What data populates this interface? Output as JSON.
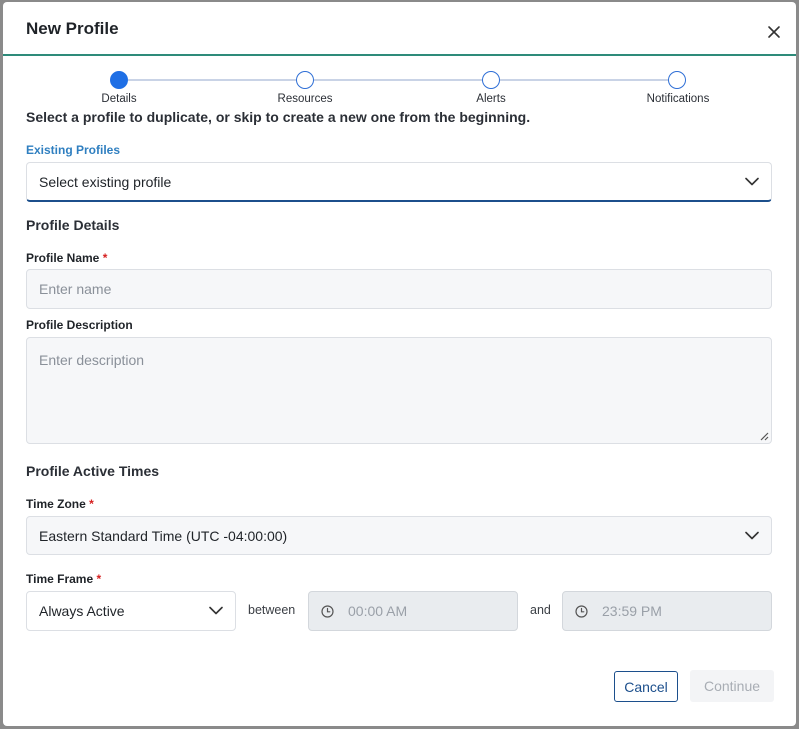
{
  "modal": {
    "title": "New Profile"
  },
  "stepper": {
    "steps": [
      {
        "label": "Details",
        "state": "active"
      },
      {
        "label": "Resources",
        "state": "pending"
      },
      {
        "label": "Alerts",
        "state": "pending"
      },
      {
        "label": "Notifications",
        "state": "pending"
      }
    ]
  },
  "instruction": "Select a profile to duplicate, or skip to create a new one from the beginning.",
  "existing_profiles": {
    "label": "Existing Profiles",
    "value": "Select existing profile"
  },
  "profile_details": {
    "section_title": "Profile Details",
    "name_label": "Profile Name",
    "name_placeholder": "Enter name",
    "name_value": "",
    "description_label": "Profile Description",
    "description_placeholder": "Enter description",
    "description_value": ""
  },
  "active_times": {
    "section_title": "Profile Active Times",
    "timezone_label": "Time Zone",
    "timezone_value": "Eastern Standard Time (UTC -04:00:00)",
    "timeframe_label": "Time Frame",
    "timeframe_value": "Always Active",
    "between_word": "between",
    "and_word": "and",
    "start_time": "00:00 AM",
    "end_time": "23:59 PM"
  },
  "required_marker": "*",
  "footer": {
    "cancel_label": "Cancel",
    "continue_label": "Continue"
  },
  "colors": {
    "accent_blue": "#1f6fe5",
    "header_rule": "#2e8b7a",
    "link_blue": "#2f7fc0",
    "button_navy": "#1c4f8c",
    "required_red": "#d62020"
  }
}
